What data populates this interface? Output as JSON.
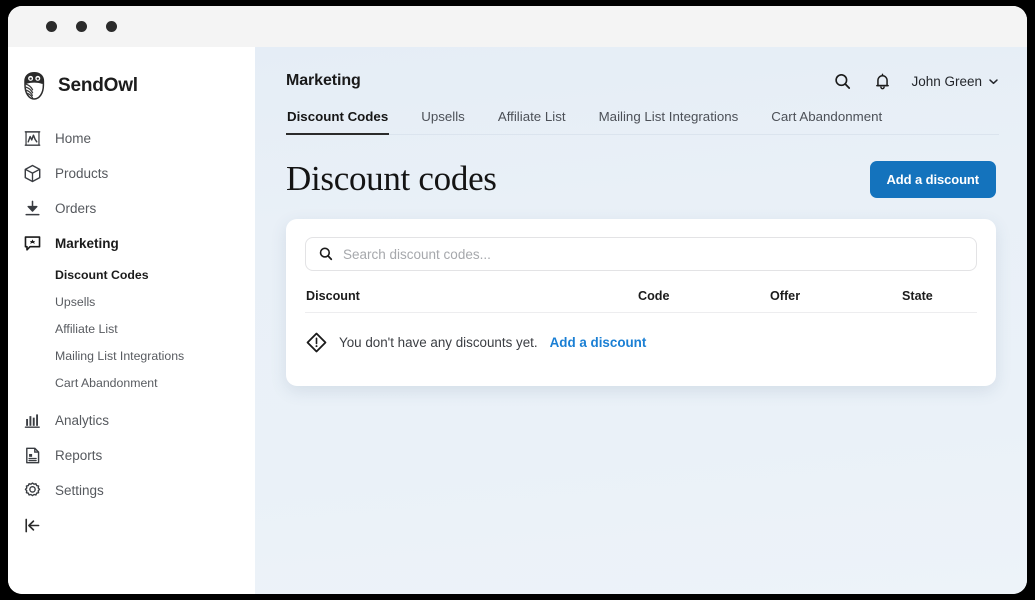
{
  "window": {
    "traffic_lights": [
      "close",
      "minimize",
      "maximize"
    ]
  },
  "brand": {
    "name": "SendOwl",
    "logo_icon": "owl-logo-icon"
  },
  "sidebar": {
    "items": [
      {
        "label": "Home",
        "icon": "home-chart-icon",
        "active": false
      },
      {
        "label": "Products",
        "icon": "box-icon",
        "active": false
      },
      {
        "label": "Orders",
        "icon": "download-icon",
        "active": false
      },
      {
        "label": "Marketing",
        "icon": "megaphone-icon",
        "active": true
      }
    ],
    "marketing_subitems": [
      {
        "label": "Discount Codes",
        "active": true
      },
      {
        "label": "Upsells",
        "active": false
      },
      {
        "label": "Affiliate List",
        "active": false
      },
      {
        "label": "Mailing List Integrations",
        "active": false
      },
      {
        "label": "Cart Abandonment",
        "active": false
      }
    ],
    "lower_items": [
      {
        "label": "Analytics",
        "icon": "bar-chart-icon",
        "active": false
      },
      {
        "label": "Reports",
        "icon": "document-icon",
        "active": false
      },
      {
        "label": "Settings",
        "icon": "gear-icon",
        "active": false
      }
    ],
    "logout_icon": "logout-icon"
  },
  "header": {
    "title": "Marketing",
    "search_icon": "search-icon",
    "bell_icon": "bell-icon",
    "user_name": "John Green",
    "chevron_icon": "chevron-down-icon",
    "tabs": [
      {
        "label": "Discount Codes",
        "active": true
      },
      {
        "label": "Upsells",
        "active": false
      },
      {
        "label": "Affiliate List",
        "active": false
      },
      {
        "label": "Mailing List Integrations",
        "active": false
      },
      {
        "label": "Cart Abandonment",
        "active": false
      }
    ]
  },
  "page": {
    "title": "Discount codes",
    "add_button_label": "Add a discount"
  },
  "search": {
    "placeholder": "Search discount codes...",
    "value": "",
    "icon": "search-icon"
  },
  "table": {
    "columns": [
      "Discount",
      "Code",
      "Offer",
      "State"
    ],
    "rows": [],
    "empty_state": {
      "icon": "alert-diamond-icon",
      "text": "You don't have any discounts yet.",
      "link_label": "Add a discount"
    }
  },
  "colors": {
    "accent_blue": "#1473bd",
    "link_blue": "#1a7fd4",
    "page_background": "#eaf1f8",
    "sidebar_background": "#ffffff",
    "titlebar_background": "#f4f4f4",
    "text_dark": "#1b1b1b",
    "text_muted": "#56595e"
  }
}
